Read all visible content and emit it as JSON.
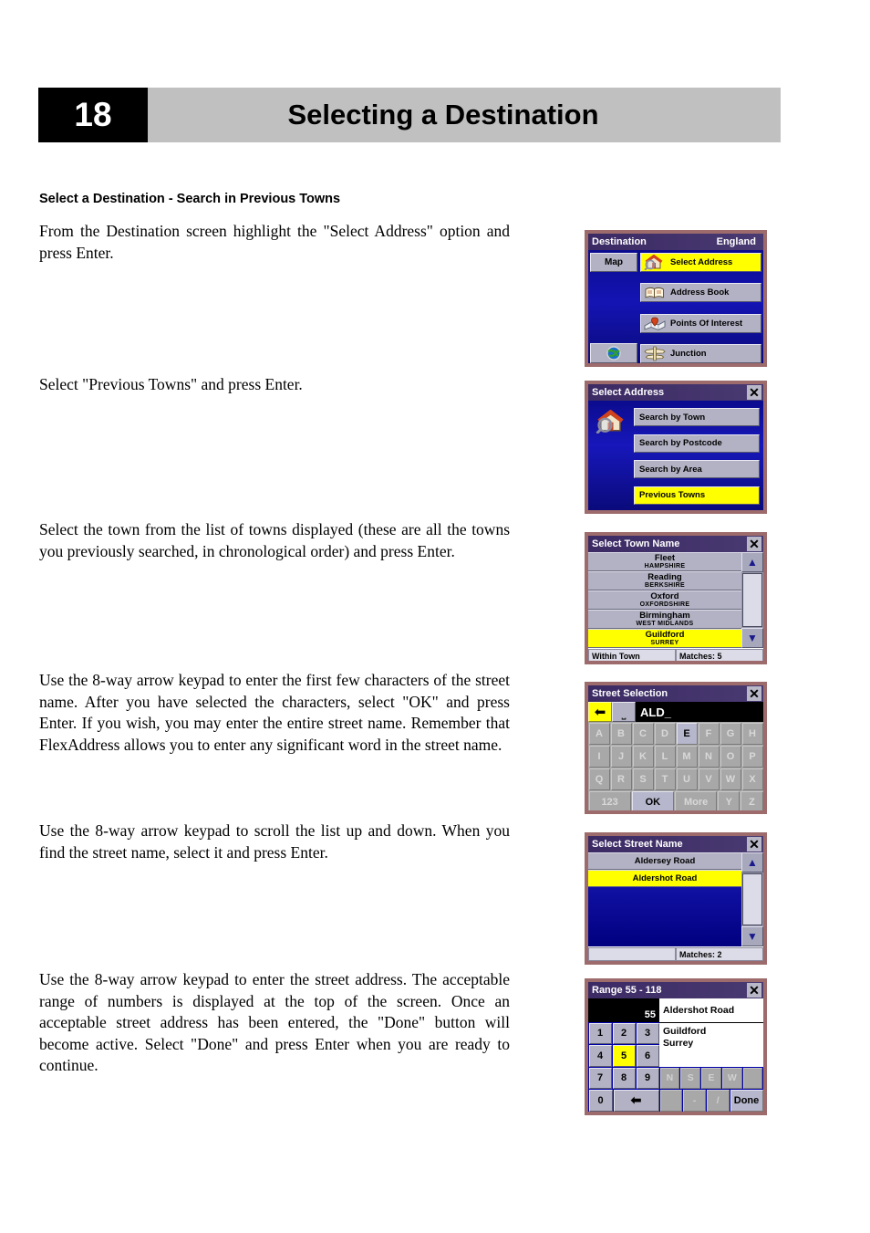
{
  "page": {
    "number": "18",
    "title": "Selecting a Destination",
    "section_heading": "Select a Destination - Search in Previous Towns"
  },
  "steps": [
    {
      "id": "step-1",
      "text": "From the Destination screen highlight the \"Select Address\" option and press Enter."
    },
    {
      "id": "step-2",
      "text": "Select \"Previous Towns\" and press Enter."
    },
    {
      "id": "step-3",
      "text": "Select the town from the list of towns displayed (these are all the towns you previously searched, in chronological order) and press Enter."
    },
    {
      "id": "step-4",
      "text": "Use the 8-way arrow keypad to enter the first few characters of the street name. After you have selected the characters, select \"OK\" and press Enter. If you wish, you may enter the entire street name. Remember that FlexAddress allows you to enter any significant word in the street name."
    },
    {
      "id": "step-5",
      "text": "Use the 8-way arrow keypad to scroll the list up and down. When you find the street name, select it and press Enter."
    },
    {
      "id": "step-6",
      "text": "Use the 8-way arrow keypad to enter the street address. The acceptable range of numbers is displayed at the top of the screen. Once an acceptable street address has been entered, the \"Done\" button will become active. Select \"Done\" and press Enter when you are ready to continue."
    }
  ],
  "screens": {
    "destination": {
      "title": "Destination",
      "region": "England",
      "map_button": "Map",
      "globe_icon": "globe-icon",
      "items": [
        {
          "label": "Select Address",
          "icon": "house-search-icon",
          "selected": true
        },
        {
          "label": "Address Book",
          "icon": "open-book-icon",
          "selected": false
        },
        {
          "label": "Points Of Interest",
          "icon": "map-pin-icon",
          "selected": false
        },
        {
          "label": "Junction",
          "icon": "signpost-icon",
          "selected": false
        }
      ]
    },
    "select_address": {
      "title": "Select Address",
      "close_icon": "close-icon",
      "side_icon": "house-search-icon",
      "items": [
        {
          "label": "Search by Town",
          "selected": false
        },
        {
          "label": "Search by Postcode",
          "selected": false
        },
        {
          "label": "Search by Area",
          "selected": false
        },
        {
          "label": "Previous Towns",
          "selected": true
        }
      ]
    },
    "select_town_name": {
      "title": "Select Town Name",
      "close_icon": "close-icon",
      "rows": [
        {
          "town": "Fleet",
          "county": "HAMPSHIRE",
          "selected": false
        },
        {
          "town": "Reading",
          "county": "BERKSHIRE",
          "selected": false
        },
        {
          "town": "Oxford",
          "county": "OXFORDSHIRE",
          "selected": false
        },
        {
          "town": "Birmingham",
          "county": "WEST MIDLANDS",
          "selected": false
        },
        {
          "town": "Guildford",
          "county": "SURREY",
          "selected": true
        }
      ],
      "scroll_up_icon": "triangle-up-icon",
      "scroll_down_icon": "triangle-down-icon",
      "footer_left": "Within Town",
      "footer_right": "Matches:  5"
    },
    "street_selection": {
      "title": "Street Selection",
      "close_icon": "close-icon",
      "backspace_icon": "backspace-arrow-icon",
      "space_icon": "space-bar-icon",
      "input_value": "ALD_",
      "keyboard_rows": [
        [
          "A",
          "B",
          "C",
          "D",
          "E",
          "F",
          "G",
          "H"
        ],
        [
          "I",
          "J",
          "K",
          "L",
          "M",
          "N",
          "O",
          "P"
        ],
        [
          "Q",
          "R",
          "S",
          "T",
          "U",
          "V",
          "W",
          "X"
        ]
      ],
      "bottom_row": [
        "123",
        "OK",
        "More",
        "Y",
        "Z"
      ],
      "active_key": "E",
      "active_bottom_key": "OK"
    },
    "select_street_name": {
      "title": "Select Street Name",
      "close_icon": "close-icon",
      "rows": [
        {
          "name": "Aldersey Road",
          "selected": false
        },
        {
          "name": "Aldershot Road",
          "selected": true
        }
      ],
      "scroll_up_icon": "triangle-up-icon",
      "scroll_down_icon": "triangle-down-icon",
      "footer_left": "",
      "footer_right": "Matches:  2"
    },
    "range": {
      "title": "Range 55 - 118",
      "close_icon": "close-icon",
      "entered_value": "55",
      "street": "Aldershot Road",
      "town": "Guildford",
      "county": "Surrey",
      "keypad_rows": [
        [
          "1",
          "2",
          "3"
        ],
        [
          "4",
          "5",
          "6"
        ],
        [
          "7",
          "8",
          "9"
        ]
      ],
      "bottom_keys": [
        "0",
        "backspace-arrow-icon"
      ],
      "selected_key": "5",
      "direction_keys": [
        "N",
        "S",
        "E",
        "W",
        ""
      ],
      "symbol_keys": [
        "",
        "-",
        "/"
      ],
      "done_label": "Done"
    }
  },
  "colors": {
    "header_bar": "#c0c0c0",
    "page_box": "#000000",
    "device_frame": "#9d6b6b",
    "titlebar": "#3b2a63",
    "screen_blue": "#0b0b8e",
    "highlight_yellow": "#ffff00",
    "button_face": "#b2b2c4",
    "keyboard_face": "#a8a8a8"
  }
}
